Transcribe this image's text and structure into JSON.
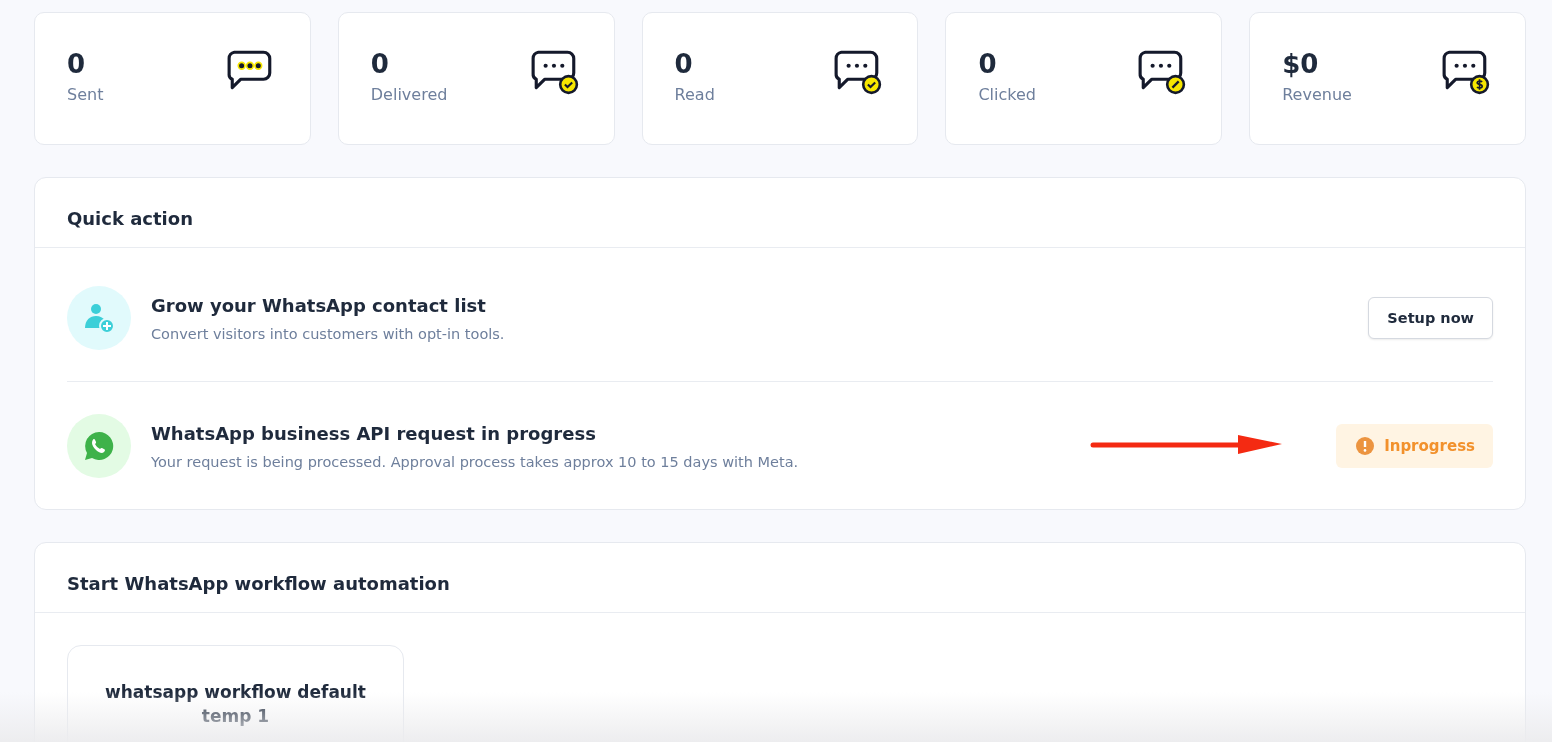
{
  "stats": [
    {
      "value": "0",
      "label": "Sent",
      "kind": "plain"
    },
    {
      "value": "0",
      "label": "Delivered",
      "kind": "check"
    },
    {
      "value": "0",
      "label": "Read",
      "kind": "check"
    },
    {
      "value": "0",
      "label": "Clicked",
      "kind": "edit"
    },
    {
      "value": "$0",
      "label": "Revenue",
      "kind": "money"
    }
  ],
  "quick_action": {
    "title": "Quick action",
    "items": [
      {
        "kind": "contact",
        "title": "Grow your WhatsApp contact list",
        "description": "Convert visitors into customers with opt-in tools.",
        "action": {
          "kind": "button",
          "label": "Setup now"
        }
      },
      {
        "kind": "whatsapp",
        "title": "WhatsApp business API request in progress",
        "description": "Your request is being processed. Approval process takes approx 10 to 15 days with Meta.",
        "action": {
          "kind": "status",
          "label": "Inprogress"
        }
      }
    ]
  },
  "workflow": {
    "title": "Start WhatsApp workflow automation",
    "templates": [
      {
        "title": "whatsapp workflow default temp 1"
      }
    ]
  }
}
